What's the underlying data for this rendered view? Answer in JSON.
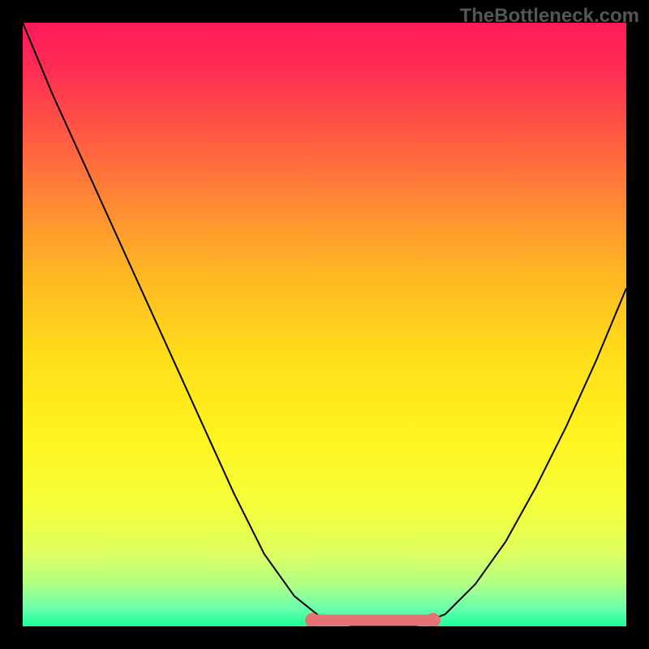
{
  "watermark": "TheBottleneck.com",
  "chart_data": {
    "type": "line",
    "title": "",
    "xlabel": "",
    "ylabel": "",
    "xlim": [
      0,
      1
    ],
    "ylim": [
      0,
      1
    ],
    "x": [
      0.0,
      0.05,
      0.1,
      0.15,
      0.2,
      0.25,
      0.3,
      0.35,
      0.4,
      0.45,
      0.5,
      0.55,
      0.6,
      0.65,
      0.7,
      0.75,
      0.8,
      0.85,
      0.9,
      0.95,
      1.0
    ],
    "values": [
      1.0,
      0.88,
      0.77,
      0.66,
      0.55,
      0.44,
      0.33,
      0.22,
      0.12,
      0.05,
      0.01,
      0.0,
      0.0,
      0.0,
      0.02,
      0.07,
      0.14,
      0.23,
      0.33,
      0.44,
      0.56
    ],
    "background": "rainbow-vertical",
    "highlight_region": {
      "x0": 0.48,
      "x1": 0.68,
      "y": 0.01,
      "color": "#e57373"
    }
  }
}
